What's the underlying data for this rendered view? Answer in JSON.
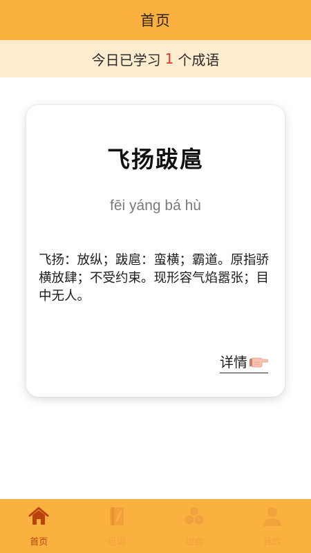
{
  "header": {
    "title": "首页"
  },
  "progress": {
    "prefix": "今日已学习",
    "count": "1",
    "suffix": "个成语"
  },
  "card": {
    "idiom": "飞扬跋扈",
    "pinyin": "fēi yáng bá hù",
    "definition": "飞扬：放纵；跋扈：蛮横；霸道。原指骄横放肆；不受约束。现形容气焰嚣张；目中无人。",
    "details_label": "详情",
    "details_icon": "pointing-hand-icon"
  },
  "nav": {
    "items": [
      {
        "label": "首页",
        "icon": "home-icon",
        "active": true
      },
      {
        "label": "组词",
        "icon": "book-icon",
        "active": false
      },
      {
        "label": "组合",
        "icon": "group-icon",
        "active": false
      },
      {
        "label": "我的",
        "icon": "user-icon",
        "active": false
      }
    ]
  },
  "colors": {
    "accent": "#fbb13f",
    "banner": "#fdeccd",
    "highlight": "#e5352a",
    "nav_active": "#b8430c",
    "nav_inactive": "#f2a23d"
  }
}
